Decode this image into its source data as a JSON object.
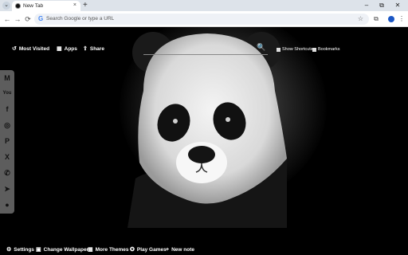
{
  "browser": {
    "tab_title": "New Tab",
    "tab_close": "×",
    "new_tab": "+",
    "menu_icon": "chevron-down-icon",
    "window_controls": [
      "–",
      "⧉",
      "✕"
    ]
  },
  "toolbar": {
    "back": "←",
    "forward": "→",
    "reload": "⟳",
    "google_g": "G",
    "omnibox_placeholder": "Search Google or type a URL",
    "star": "☆",
    "extensions": "⧉",
    "menu": "⋮"
  },
  "content": {
    "top_left": [
      {
        "icon": "↺",
        "label": "Most Visited"
      },
      {
        "icon": "▦",
        "label": "Apps"
      },
      {
        "icon": "⇪",
        "label": "Share"
      }
    ],
    "search_icon": "🔍",
    "top_right": [
      {
        "label": "Show Shortcuts"
      },
      {
        "label": "Bookmarks"
      }
    ],
    "sidebar": [
      {
        "icon": "gmail-icon",
        "glyph": "M"
      },
      {
        "icon": "youtube-icon",
        "glyph": "You"
      },
      {
        "icon": "facebook-icon",
        "glyph": "f"
      },
      {
        "icon": "instagram-icon",
        "glyph": "◎"
      },
      {
        "icon": "pinterest-icon",
        "glyph": "P"
      },
      {
        "icon": "x-icon",
        "glyph": "X"
      },
      {
        "icon": "whatsapp-icon",
        "glyph": "✆"
      },
      {
        "icon": "telegram-icon",
        "glyph": "➤"
      },
      {
        "icon": "reddit-icon",
        "glyph": "●"
      }
    ],
    "bottom": [
      {
        "icon": "⚙",
        "label": "Settings"
      },
      {
        "icon": "▣",
        "label": "Change Wallpaper"
      },
      {
        "icon": "▦",
        "label": "More Themes"
      },
      {
        "icon": "✪",
        "label": "Play Games"
      },
      {
        "icon": "+",
        "label": "New note"
      }
    ]
  }
}
